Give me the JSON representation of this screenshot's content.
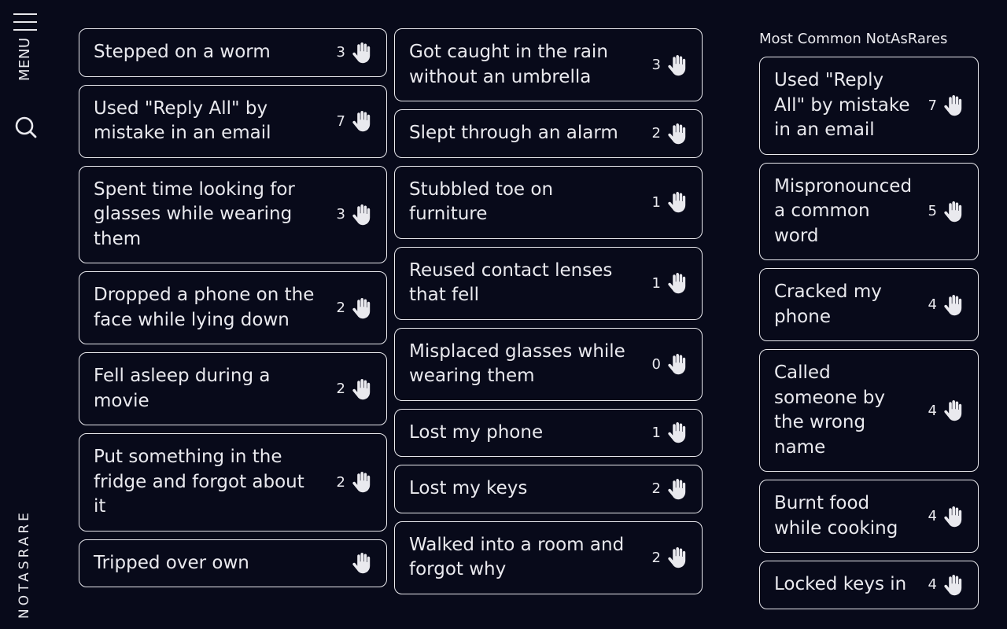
{
  "nav": {
    "menu_label": "MENU",
    "brand": "NOTASRARE"
  },
  "column1": [
    {
      "text": "Stepped on a worm",
      "count": "3"
    },
    {
      "text": "Used \"Reply All\" by mistake in an email",
      "count": "7"
    },
    {
      "text": "Spent time looking for glasses while wearing them",
      "count": "3"
    },
    {
      "text": "Dropped a phone on the face while lying down",
      "count": "2"
    },
    {
      "text": "Fell asleep during a movie",
      "count": "2"
    },
    {
      "text": "Put something in the fridge and forgot about it",
      "count": "2"
    },
    {
      "text": "Tripped over own",
      "count": ""
    }
  ],
  "column2": [
    {
      "text": "Got caught in the rain without an umbrella",
      "count": "3"
    },
    {
      "text": "Slept through an alarm",
      "count": "2"
    },
    {
      "text": "Stubbled toe on furniture",
      "count": "1"
    },
    {
      "text": "Reused contact lenses that fell",
      "count": "1"
    },
    {
      "text": "Misplaced glasses while wearing them",
      "count": "0"
    },
    {
      "text": "Lost my phone",
      "count": "1"
    },
    {
      "text": "Lost my keys",
      "count": "2"
    },
    {
      "text": "Walked into a room and forgot why",
      "count": "2"
    }
  ],
  "sidebar": {
    "title": "Most Common NotAsRares",
    "items": [
      {
        "text": "Used \"Reply All\" by mistake in an email",
        "count": "7"
      },
      {
        "text": "Mispronounced a common word",
        "count": "5"
      },
      {
        "text": "Cracked my phone",
        "count": "4"
      },
      {
        "text": "Called someone by the wrong name",
        "count": "4"
      },
      {
        "text": "Burnt food while cooking",
        "count": "4"
      },
      {
        "text": "Locked keys in",
        "count": "4"
      }
    ]
  },
  "icons": {
    "menu": "hamburger-icon",
    "search": "search-icon",
    "hand": "raised-hand-icon"
  },
  "colors": {
    "background": "#080a1a",
    "foreground": "#e9e9ee"
  }
}
